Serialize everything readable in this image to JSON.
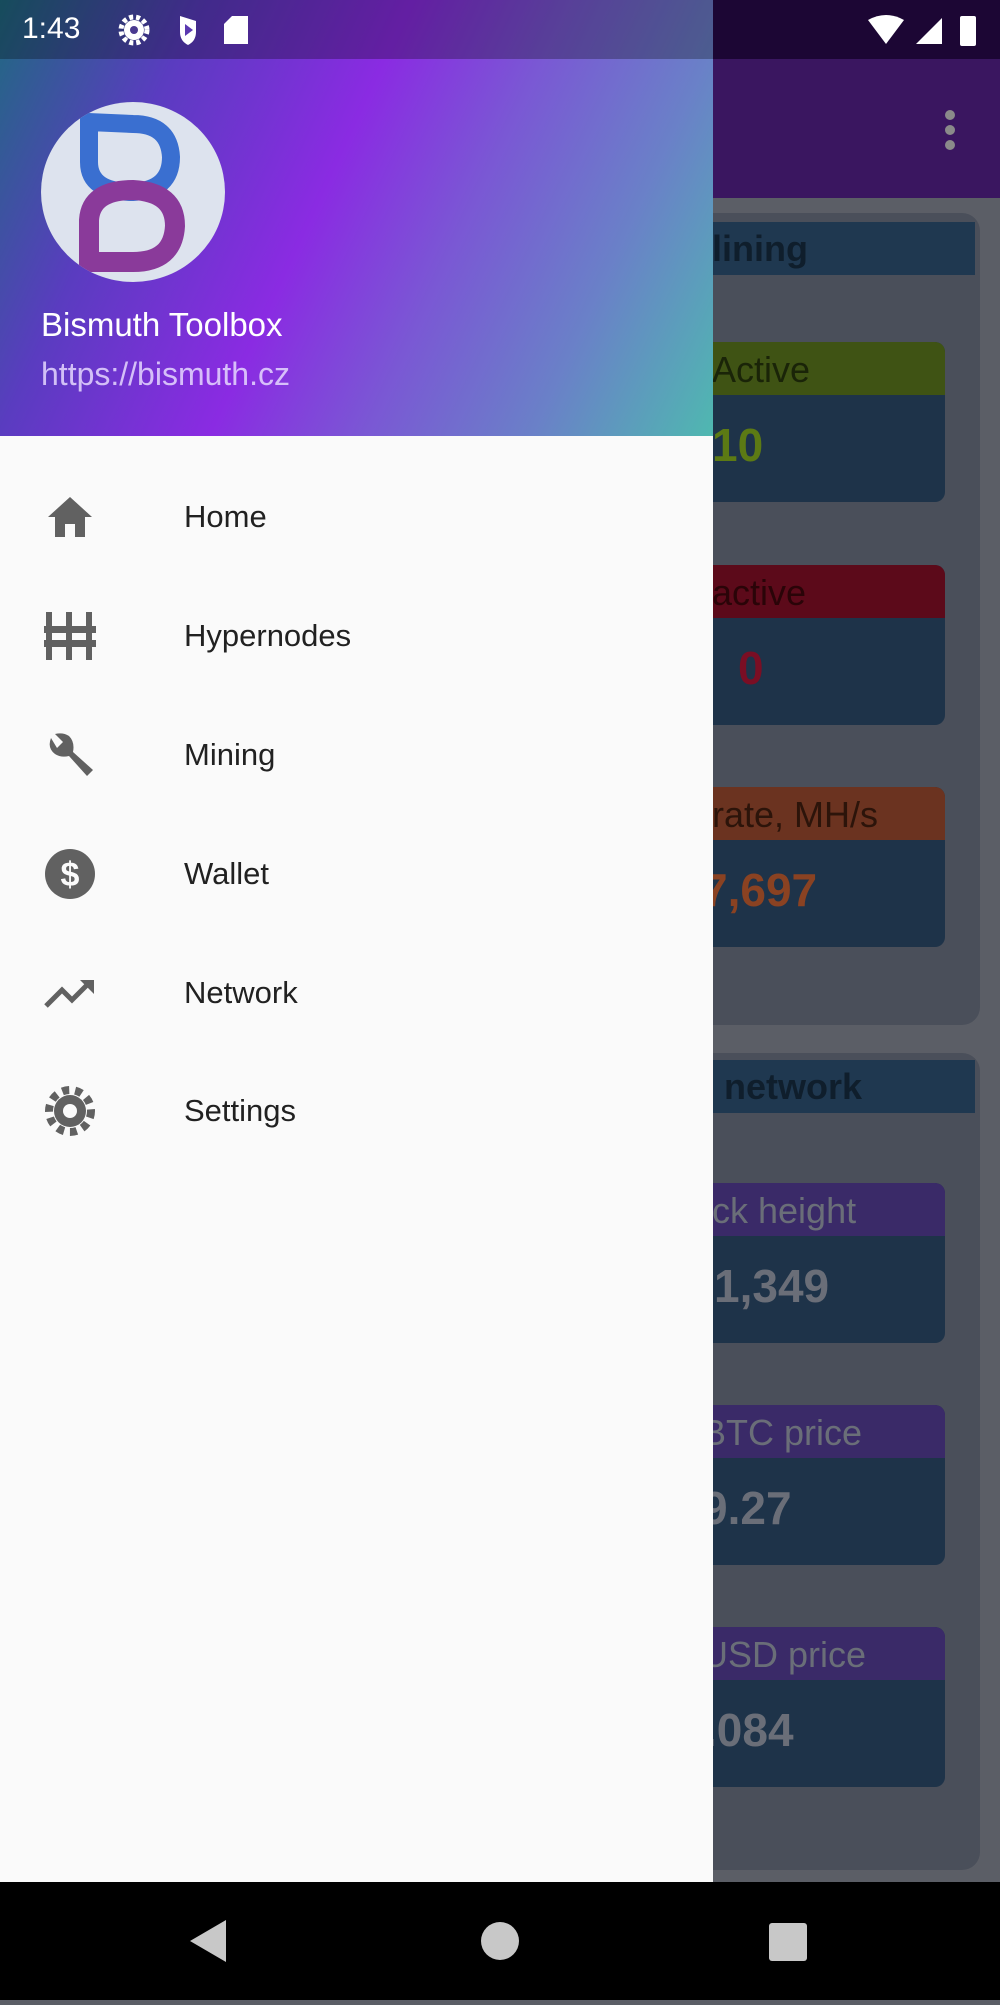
{
  "status_bar": {
    "time": "1:43",
    "icons": [
      "settings-icon",
      "shield-play-icon",
      "sd-card-icon",
      "wifi-icon",
      "signal-icon",
      "battery-icon"
    ]
  },
  "drawer": {
    "app_title": "Bismuth Toolbox",
    "app_url": "https://bismuth.cz",
    "items": [
      {
        "label": "Home",
        "icon": "home-icon"
      },
      {
        "label": "Hypernodes",
        "icon": "hypernodes-icon"
      },
      {
        "label": "Mining",
        "icon": "wrench-icon"
      },
      {
        "label": "Wallet",
        "icon": "dollar-icon"
      },
      {
        "label": "Network",
        "icon": "trending-up-icon"
      },
      {
        "label": "Settings",
        "icon": "gear-icon"
      }
    ]
  },
  "background": {
    "mining_card": {
      "title": "lining",
      "tiles": [
        {
          "label": "Active",
          "value": "10",
          "header_color": "#3f5314",
          "value_color": "#5c7a14"
        },
        {
          "label": "active",
          "value": "0",
          "header_color": "#5c0a1a",
          "value_color": "#7a0e24"
        },
        {
          "label": "rate, MH/s",
          "value": "7,697",
          "header_color": "#6b3320",
          "value_color": "#8a4222"
        }
      ]
    },
    "network_card": {
      "title": "network",
      "tiles": [
        {
          "label": "ck height",
          "value": "1,349",
          "header_color": "#3a2a68",
          "value_color": "#6a6e78"
        },
        {
          "label": "BTC price",
          "value": "9.27",
          "header_color": "#3a2a68",
          "value_color": "#6a6e78"
        },
        {
          "label": "USD price",
          "value": ".084",
          "header_color": "#3a2a68",
          "value_color": "#6a6e78"
        }
      ]
    }
  },
  "colors": {
    "accent": "#8a2be2",
    "drawer_bg": "#fafafa",
    "icon": "#616161"
  }
}
